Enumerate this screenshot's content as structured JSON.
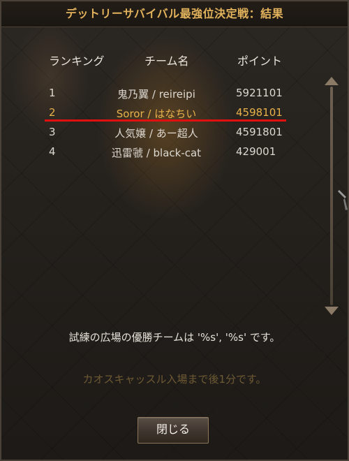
{
  "title": "デットリーサバイバル最強位決定戦：結果",
  "headers": {
    "rank": "ランキング",
    "team": "チーム名",
    "points": "ポイント"
  },
  "rows": [
    {
      "rank": "1",
      "team": "鬼乃翼 / reireipi",
      "points": "5921101"
    },
    {
      "rank": "2",
      "team": "Soror / はなちい",
      "points": "4598101"
    },
    {
      "rank": "3",
      "team": "人気嬢 / あー超人",
      "points": "4591801"
    },
    {
      "rank": "4",
      "team": "迅雷虢 / black-cat",
      "points": "429001"
    }
  ],
  "message": "試練の広場の優勝チームは '%s', '%s' です。",
  "hint": "カオスキャッスル入場まで後1分です。",
  "close_button": "閉じる",
  "colors": {
    "title": "#e2b25c",
    "highlight": "#e8b24a",
    "underline": "#e01010",
    "hint": "#6e5a33"
  }
}
